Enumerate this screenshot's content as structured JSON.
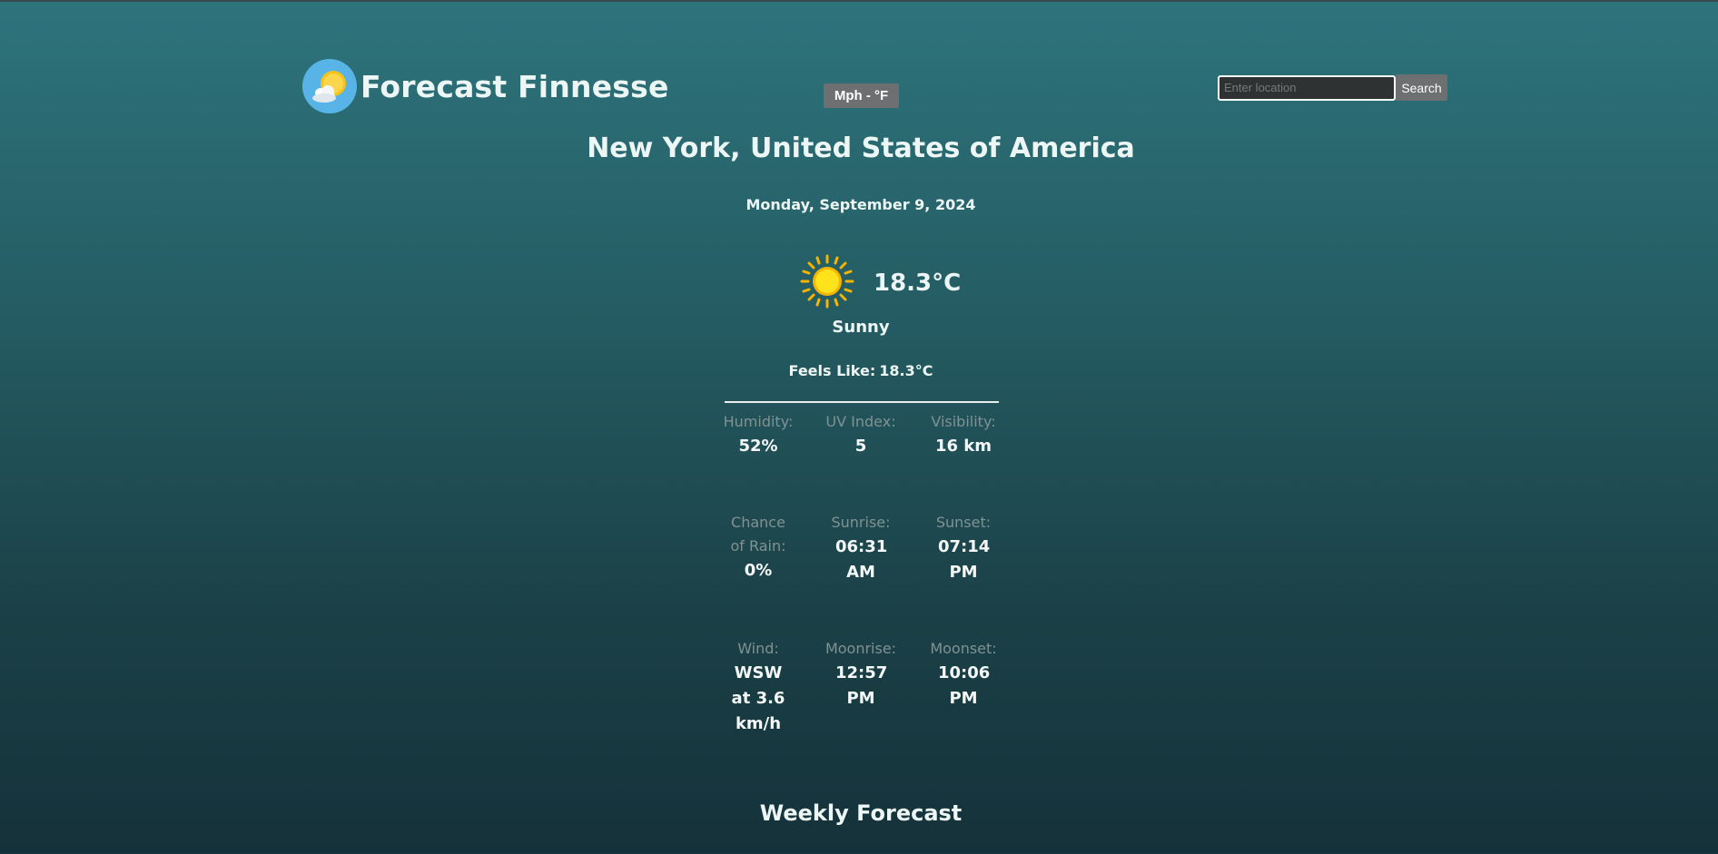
{
  "app": {
    "title": "Forecast Finnesse"
  },
  "header": {
    "unit_toggle_label": "Mph - °F",
    "search": {
      "placeholder": "Enter location",
      "value": "",
      "button_label": "Search"
    }
  },
  "current": {
    "location": "New York, United States of America",
    "date": "Monday, September 9, 2024",
    "temperature": "18.3°C",
    "condition": "Sunny",
    "condition_icon": "sun-icon",
    "feels_like_label": "Feels Like:",
    "feels_like_value": "18.3°C"
  },
  "stats": [
    {
      "label": "Humidity:",
      "value": "52%"
    },
    {
      "label": "UV Index:",
      "value": "5"
    },
    {
      "label": "Visibility:",
      "value": "16 km"
    },
    {
      "label": "Chance of Rain:",
      "value": "0%"
    },
    {
      "label": "Sunrise:",
      "value": "06:31 AM"
    },
    {
      "label": "Sunset:",
      "value": "07:14 PM"
    },
    {
      "label": "Wind:",
      "value": "WSW at 3.6 km/h"
    },
    {
      "label": "Moonrise:",
      "value": "12:57 PM"
    },
    {
      "label": "Moonset:",
      "value": "10:06 PM"
    }
  ],
  "weekly": {
    "title": "Weekly Forecast"
  },
  "colors": {
    "accent_button": "#6d6f70",
    "background_top": "#2e747c",
    "background_bottom": "#15313a",
    "label_muted": "#7f9294",
    "logo_circle": "#58b4e6",
    "sun": "#fdd20c"
  }
}
